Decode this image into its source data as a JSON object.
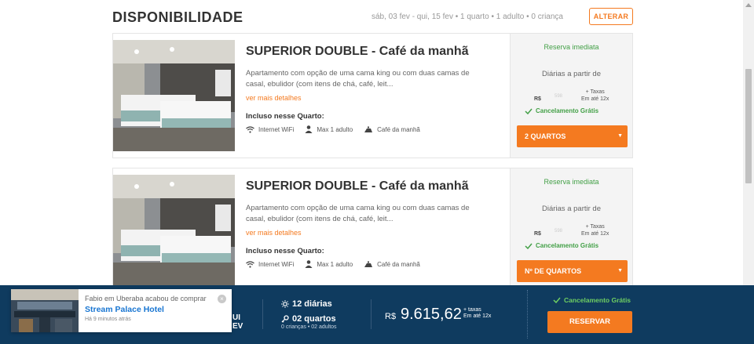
{
  "availability": {
    "title": "DISPONIBILIDADE",
    "summary": "sáb, 03 fev - qui, 15 fev • 1 quarto • 1 adulto • 0 criança",
    "alter_label": "ALTERAR"
  },
  "rooms": [
    {
      "title": "SUPERIOR DOUBLE - Café da manhã",
      "description": "Apartamento com opção de uma cama king ou com duas camas de casal, ebulidor (com itens de chá, café, leit...",
      "more_details": "ver mais detalhes",
      "included_title": "Incluso nesse Quarto:",
      "amenities": [
        {
          "icon": "wifi-icon",
          "label": "Internet WiFi"
        },
        {
          "icon": "person-icon",
          "label": "Max 1 adulto"
        },
        {
          "icon": "breakfast-icon",
          "label": "Café da manhã"
        }
      ],
      "instant_booking": "Reserva imediata",
      "daily_from": "Diárias a partir de",
      "currency": "R$",
      "price_faint": "598",
      "taxes_note": "+ Taxas",
      "installments": "Em até 12x",
      "cancellation": "Cancelamento Grátis",
      "rooms_select": "2 QUARTOS"
    },
    {
      "title": "SUPERIOR DOUBLE - Café da manhã",
      "description": "Apartamento com opção de uma cama king ou com duas camas de casal, ebulidor (com itens de chá, café, leit...",
      "more_details": "ver mais detalhes",
      "included_title": "Incluso nesse Quarto:",
      "amenities": [
        {
          "icon": "wifi-icon",
          "label": "Internet WiFi"
        },
        {
          "icon": "person-icon",
          "label": "Max 1 adulto"
        },
        {
          "icon": "breakfast-icon",
          "label": "Café da manhã"
        }
      ],
      "instant_booking": "Reserva imediata",
      "daily_from": "Diárias a partir de",
      "currency": "R$",
      "price_faint": "598",
      "taxes_note": "+ Taxas",
      "installments": "Em até 12x",
      "cancellation": "Cancelamento Grátis",
      "rooms_select": "Nº DE QUARTOS"
    }
  ],
  "booking_bar": {
    "date_stub_line1": "UI",
    "date_stub_line2": "EV",
    "nights": "12 diárias",
    "rooms": "02 quartos",
    "guests": "0 crianças • 02 adultos",
    "currency": "R$",
    "total": "9.615,62",
    "tax_line1": "+ taxas",
    "tax_line2": "Em até 12x",
    "cancellation": "Cancelamento Grátis",
    "reserve_label": "RESERVAR"
  },
  "toast": {
    "message": "Fabio em Uberaba acabou de comprar",
    "hotel": "Stream Palace Hotel",
    "time_ago": "Há 9 minutos atrás",
    "close": "×"
  },
  "colors": {
    "accent": "#f47a20",
    "success": "#43a047",
    "bar": "#0f3b5f",
    "link": "#1976d2"
  }
}
